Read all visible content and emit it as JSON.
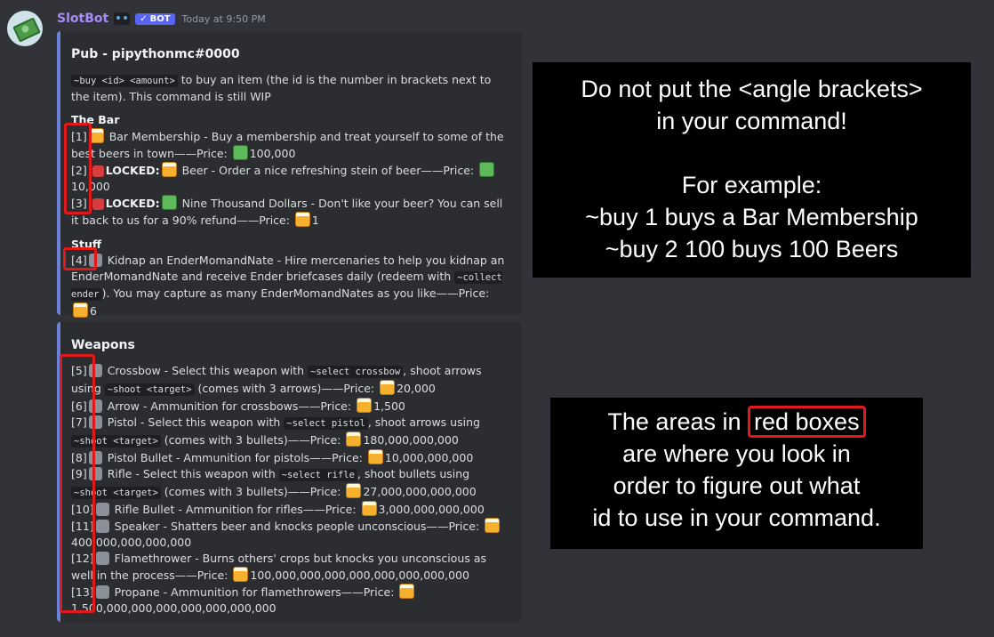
{
  "message": {
    "username": "SlotBot",
    "bot_tag": "BOT",
    "timestamp": "Today at 9:50 PM"
  },
  "embed1": {
    "title": "Pub - pipythonmc#0000",
    "usage_code": "~buy <id> <amount>",
    "usage_text": " to buy an item (the id is the number in brackets next to the item). This command is still WIP",
    "sections": [
      {
        "name": "The Bar",
        "items": [
          {
            "id": "[1]",
            "emoji": "beer",
            "text": " Bar Membership - Buy a membership and treat yourself to some of the best beers in town——Price: ",
            "price_emoji": "cash",
            "price": "100,000",
            "locked": ""
          },
          {
            "id": "[2]",
            "emoji": "beer",
            "text": " Beer - Order a nice refreshing stein of beer——Price: ",
            "price_emoji": "cash",
            "price": "10,000",
            "locked": "LOCKED:"
          },
          {
            "id": "[3]",
            "emoji": "cash",
            "text": " Nine Thousand Dollars - Don't like your beer? You can sell it back to us for a 90% refund——Price: ",
            "price_emoji": "beer",
            "price": "1",
            "locked": "LOCKED:"
          }
        ]
      },
      {
        "name": "Stuff",
        "items": [
          {
            "id": "[4]",
            "text_a": " Kidnap an EnderMomandNate - Hire mercenaries to help you kidnap an EnderMomandNate and receive Ender briefcases daily (redeem with ",
            "code": "~collect ender",
            "text_b": "). You may capture as many EnderMomandNates as you like——Price: ",
            "price": "6"
          }
        ]
      }
    ]
  },
  "embed2": {
    "title": "Weapons",
    "items": [
      {
        "id": "[5]",
        "parts": [
          " Crossbow - Select this weapon with ",
          {
            "code": "~select crossbow"
          },
          ", shoot arrows using ",
          {
            "code": "~shoot <target>"
          },
          " (comes with 3 arrows)——Price: "
        ],
        "price": "20,000"
      },
      {
        "id": "[6]",
        "parts": [
          " Arrow - Ammunition for crossbows——Price: "
        ],
        "price": "1,500"
      },
      {
        "id": "[7]",
        "parts": [
          " Pistol - Select this weapon with ",
          {
            "code": "~select pistol"
          },
          ", shoot arrows using ",
          {
            "code": "~shoot <target>"
          },
          " (comes with 3 bullets)——Price: "
        ],
        "price": "180,000,000,000"
      },
      {
        "id": "[8]",
        "parts": [
          " Pistol Bullet - Ammunition for pistols——Price: "
        ],
        "price": "10,000,000,000"
      },
      {
        "id": "[9]",
        "parts": [
          " Rifle - Select this weapon with ",
          {
            "code": "~select rifle"
          },
          ", shoot bullets using ",
          {
            "code": "~shoot <target>"
          },
          " (comes with 3 bullets)——Price: "
        ],
        "price": "27,000,000,000,000"
      },
      {
        "id": "[10]",
        "parts": [
          " Rifle Bullet - Ammunition for rifles——Price: "
        ],
        "price": "3,000,000,000,000"
      },
      {
        "id": "[11]",
        "parts": [
          " Speaker - Shatters beer and knocks people unconscious——Price: "
        ],
        "price": "400,000,000,000,000"
      },
      {
        "id": "[12]",
        "parts": [
          " Flamethrower - Burns others' crops but knocks you unconscious as well in the process——Price: "
        ],
        "price": "100,000,000,000,000,000,000,000,000"
      },
      {
        "id": "[13]",
        "parts": [
          " Propane - Ammunition for flamethrowers——Price: "
        ],
        "price": "1,500,000,000,000,000,000,000,000"
      }
    ]
  },
  "note1": {
    "lines": [
      "Do not put the <angle brackets>",
      "in your command!",
      "",
      "For example:",
      "~buy 1 buys a Bar Membership",
      "~buy 2 100 buys 100 Beers"
    ]
  },
  "note2": {
    "line1_pre": "The areas in ",
    "line1_highlight": "red boxes",
    "lines": [
      "are where you look in",
      "order to figure out what",
      "id to use in your command."
    ]
  }
}
